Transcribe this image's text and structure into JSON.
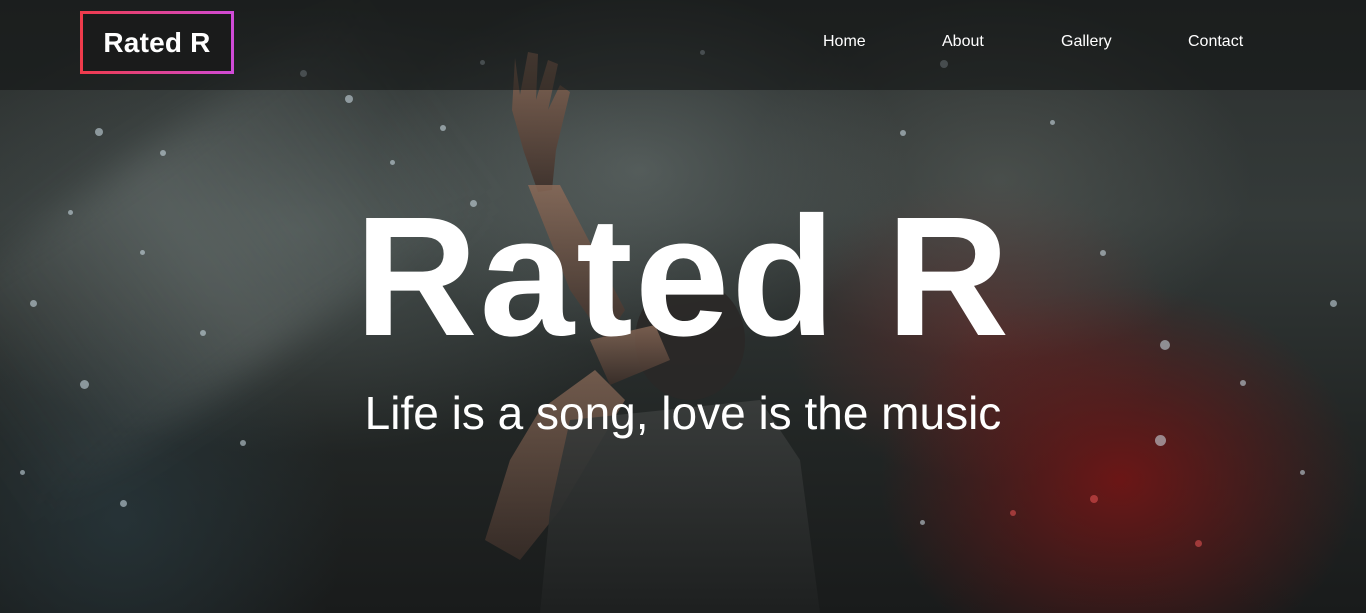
{
  "navbar": {
    "brand": "Rated R",
    "links": [
      {
        "label": "Home"
      },
      {
        "label": "About"
      },
      {
        "label": "Gallery"
      },
      {
        "label": "Contact"
      }
    ]
  },
  "hero": {
    "title": "Rated R",
    "subtitle": "Life is a song, love is the music"
  },
  "colors": {
    "brand_border_start": "#ef3b4a",
    "brand_border_end": "#d04bd8",
    "text": "#ffffff"
  }
}
